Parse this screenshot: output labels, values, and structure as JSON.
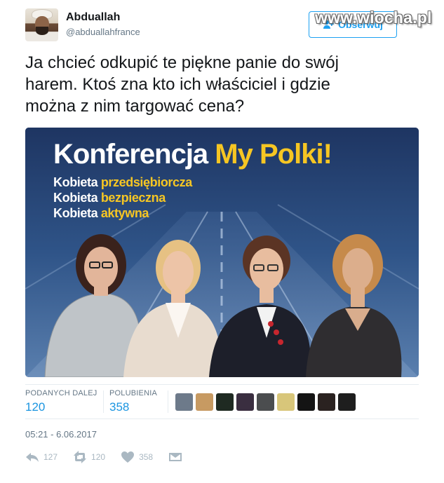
{
  "user": {
    "name": "Abduallah",
    "handle": "@abduallahfrance"
  },
  "follow_button": {
    "label": "Obserwuj"
  },
  "watermark": "www.wiocha.pl",
  "tweet": {
    "lines": [
      "Ja chcieć odkupić te piękne panie do swój",
      "harem. Ktoś zna kto ich właściciel i gdzie",
      "można z nim targować cena?"
    ]
  },
  "media": {
    "title_white": "Konferencja ",
    "title_highlight": "My Polki!",
    "subtitles": [
      {
        "white": "Kobieta ",
        "highlight": "przedsiębiorcza"
      },
      {
        "white": "Kobieta ",
        "highlight": "bezpieczna"
      },
      {
        "white": "Kobieta ",
        "highlight": "aktywna"
      }
    ]
  },
  "stats": {
    "retweets_label": "PODANYCH DALEJ",
    "retweets_value": "120",
    "likes_label": "POLUBIENIA",
    "likes_value": "358"
  },
  "likers_colors": [
    "#6d7a8a",
    "#c79a62",
    "#1f2a22",
    "#3a2e40",
    "#4b4d4f",
    "#d8c67a",
    "#141414",
    "#2a2220",
    "#1e1e1e"
  ],
  "timestamp": "05:21 - 6.06.2017",
  "actions": {
    "reply_count": "127",
    "retweet_count": "120",
    "like_count": "358"
  },
  "colors": {
    "accent": "#1da1f2",
    "link": "#1b95e0",
    "muted": "#657786",
    "highlight": "#f6c623"
  }
}
